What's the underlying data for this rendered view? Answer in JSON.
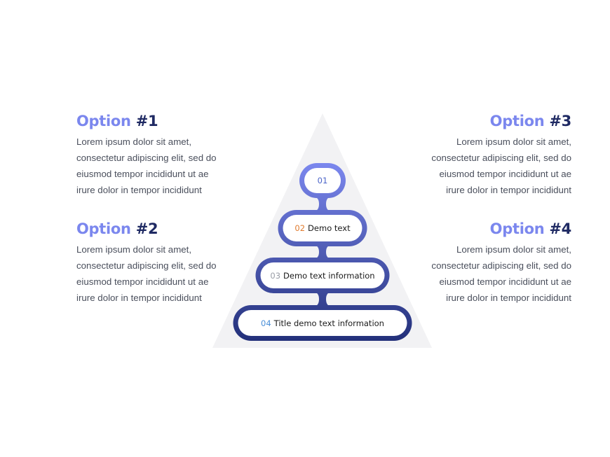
{
  "options": [
    {
      "word": "Option",
      "number": "#1",
      "lines": [
        "Lorem ipsum dolor sit amet,",
        "consectetur adipiscing elit, sed do",
        "eiusmod tempor incididunt ut ae",
        "irure dolor in tempor incididunt"
      ]
    },
    {
      "word": "Option",
      "number": "#2",
      "lines": [
        "Lorem ipsum dolor sit amet,",
        "consectetur adipiscing elit, sed do",
        "eiusmod tempor incididunt ut ae",
        "irure dolor in tempor incididunt"
      ]
    },
    {
      "word": "Option",
      "number": "#3",
      "lines": [
        "Lorem ipsum dolor sit amet,",
        "consectetur adipiscing elit, sed do",
        "eiusmod tempor incididunt ut ae",
        "irure dolor in tempor incididunt"
      ]
    },
    {
      "word": "Option",
      "number": "#4",
      "lines": [
        "Lorem ipsum dolor sit amet,",
        "consectetur adipiscing elit, sed do",
        "eiusmod tempor incididunt ut ae",
        "irure dolor in tempor incididunt"
      ]
    }
  ],
  "pyramid": {
    "steps": [
      {
        "index": "01",
        "text": "",
        "index_color": "#4a63c8"
      },
      {
        "index": "02",
        "text": "Demo text",
        "index_color": "#e07b2e"
      },
      {
        "index": "03",
        "text": "Demo text information",
        "index_color": "#9a9da6"
      },
      {
        "index": "04",
        "text": "Title demo text information",
        "index_color": "#4a8fd8"
      }
    ]
  },
  "colors": {
    "accent_light": "#7b87ee",
    "accent_dark": "#23307a",
    "triangle_fill": "#f2f2f4",
    "heading_number": "#1f2a63",
    "body_text": "#4a4f5c"
  }
}
